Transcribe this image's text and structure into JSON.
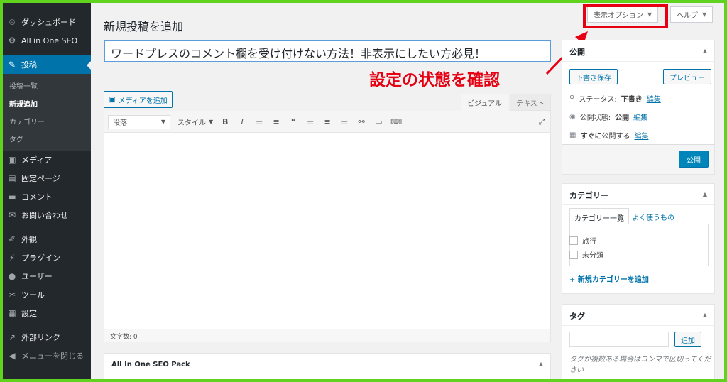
{
  "sidebar": {
    "items": [
      {
        "label": "ダッシュボード",
        "icon": "dashboard-icon",
        "glyph": "⏲"
      },
      {
        "label": "All in One SEO",
        "icon": "gear-icon",
        "glyph": "⚙"
      },
      {
        "label": "投稿",
        "icon": "pin-icon",
        "glyph": "✎",
        "active": true
      },
      {
        "label": "メディア",
        "icon": "media-icon",
        "glyph": "▣"
      },
      {
        "label": "固定ページ",
        "icon": "page-icon",
        "glyph": "▤"
      },
      {
        "label": "コメント",
        "icon": "comment-icon",
        "glyph": "▬"
      },
      {
        "label": "お問い合わせ",
        "icon": "mail-icon",
        "glyph": "✉"
      },
      {
        "label": "外観",
        "icon": "brush-icon",
        "glyph": "✐"
      },
      {
        "label": "プラグイン",
        "icon": "plugin-icon",
        "glyph": "⚡"
      },
      {
        "label": "ユーザー",
        "icon": "user-icon",
        "glyph": "●"
      },
      {
        "label": "ツール",
        "icon": "wrench-icon",
        "glyph": "✂"
      },
      {
        "label": "設定",
        "icon": "settings-icon",
        "glyph": "▦"
      },
      {
        "label": "外部リンク",
        "icon": "external-link-icon",
        "glyph": "↗"
      },
      {
        "label": "メニューを閉じる",
        "icon": "collapse-icon",
        "glyph": "◀"
      }
    ],
    "submenu": [
      "投稿一覧",
      "新規追加",
      "カテゴリー",
      "タグ"
    ]
  },
  "header": {
    "title": "新規投稿を追加",
    "screen_options": "表示オプション",
    "help": "ヘルプ"
  },
  "post": {
    "title_value": "ワードプレスのコメント欄を受け付けない方法！非表示にしたい方必見！"
  },
  "annotation": {
    "text": "設定の状態を確認",
    "color": "#e60012"
  },
  "editor": {
    "add_media": "メディアを追加",
    "tab_visual": "ビジュアル",
    "tab_text": "テキスト",
    "format_select": "段落",
    "style_select": "スタイル",
    "word_count": "文字数: 0"
  },
  "seo_box": {
    "title": "All In One SEO Pack"
  },
  "publish": {
    "title": "公開",
    "save_draft": "下書き保存",
    "preview": "プレビュー",
    "status_label": "ステータス:",
    "status_value": "下書き",
    "visibility_label": "公開状態:",
    "visibility_value": "公開",
    "schedule_label": "すぐに",
    "schedule_suffix": "公開する",
    "edit": "編集",
    "publish_button": "公開"
  },
  "categories": {
    "title": "カテゴリー",
    "tab_all": "カテゴリー一覧",
    "tab_popular": "よく使うもの",
    "items": [
      "旅行",
      "未分類"
    ],
    "add_new": "+ 新規カテゴリーを追加"
  },
  "tags": {
    "title": "タグ",
    "add_button": "追加",
    "help": "タグが複数ある場合はコンマで区切ってください"
  },
  "colors": {
    "accent": "#0073aa",
    "sidebar": "#23282d",
    "frame": "#5fd31e"
  }
}
